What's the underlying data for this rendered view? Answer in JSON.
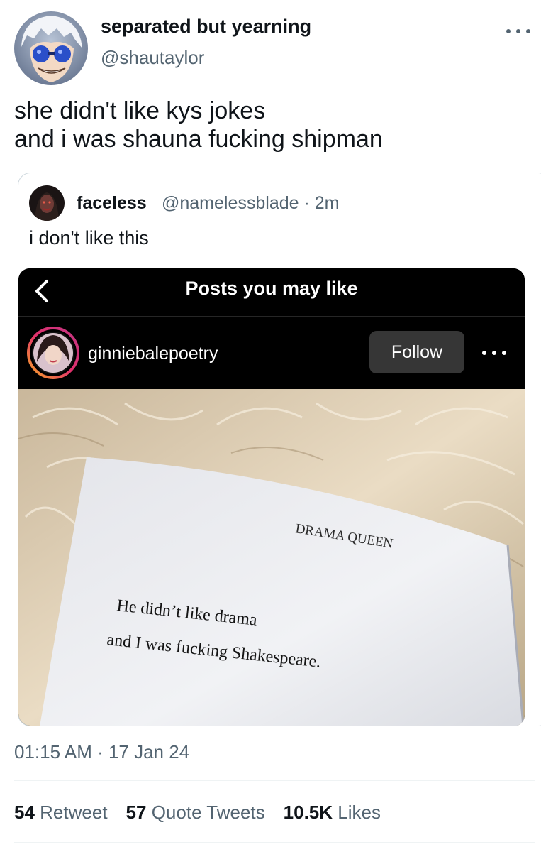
{
  "tweet": {
    "display_name": "separated but yearning",
    "handle": "@shautaylor",
    "avatar_icon": "anime-avatar-icon",
    "text_lines": [
      "she didn't like kys jokes",
      "and i was shauna fucking shipman"
    ],
    "timestamp": "01:15 AM · 17 Jan 24"
  },
  "quote": {
    "display_name": "faceless",
    "meta": "@namelessblade · 2m",
    "text": "i don't like this"
  },
  "instagram": {
    "title": "Posts you may like",
    "username": "ginniebalepoetry",
    "follow_label": "Follow",
    "book": {
      "chapter": "DRAMA QUEEN",
      "line1": "He didn’t like drama",
      "line2": "and I was fucking Shakespeare."
    }
  },
  "stats": [
    {
      "count": "54",
      "label": "Retweet"
    },
    {
      "count": "57",
      "label": "Quote Tweets"
    },
    {
      "count": "10.5K",
      "label": "Likes"
    }
  ],
  "colors": {
    "text_primary": "#0f1419",
    "text_secondary": "#536471",
    "border": "#cfd9de",
    "ig_follow_bg": "#363636"
  }
}
